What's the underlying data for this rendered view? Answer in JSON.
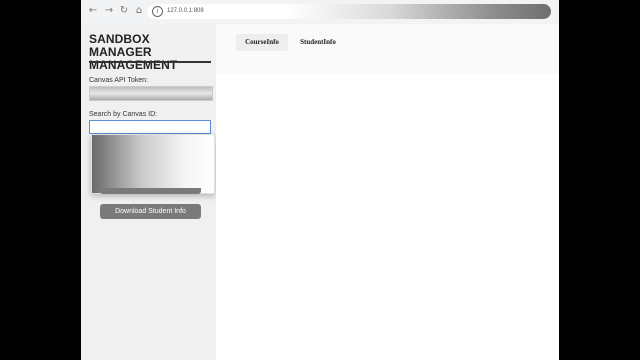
{
  "browser": {
    "url": "127.0.0.1:808"
  },
  "sidebar": {
    "title": "SANDBOX MANAGER MANAGEMENT",
    "api_token_label": "Canvas API Token:",
    "search_label": "Search by Canvas ID:",
    "download_student_label": "Download Student Info"
  },
  "tabs": [
    {
      "label": "CourseInfo",
      "active": true
    },
    {
      "label": "StudentInfo",
      "active": false
    }
  ],
  "colors": {
    "button_bg": "#7a7a7a",
    "sidebar_bg": "#f0f0f0",
    "focus_border": "#5b8bd6"
  },
  "icons": {
    "back": "arrow-left",
    "forward": "arrow-right",
    "reload": "reload",
    "home": "home",
    "site_info": "info-circle"
  }
}
